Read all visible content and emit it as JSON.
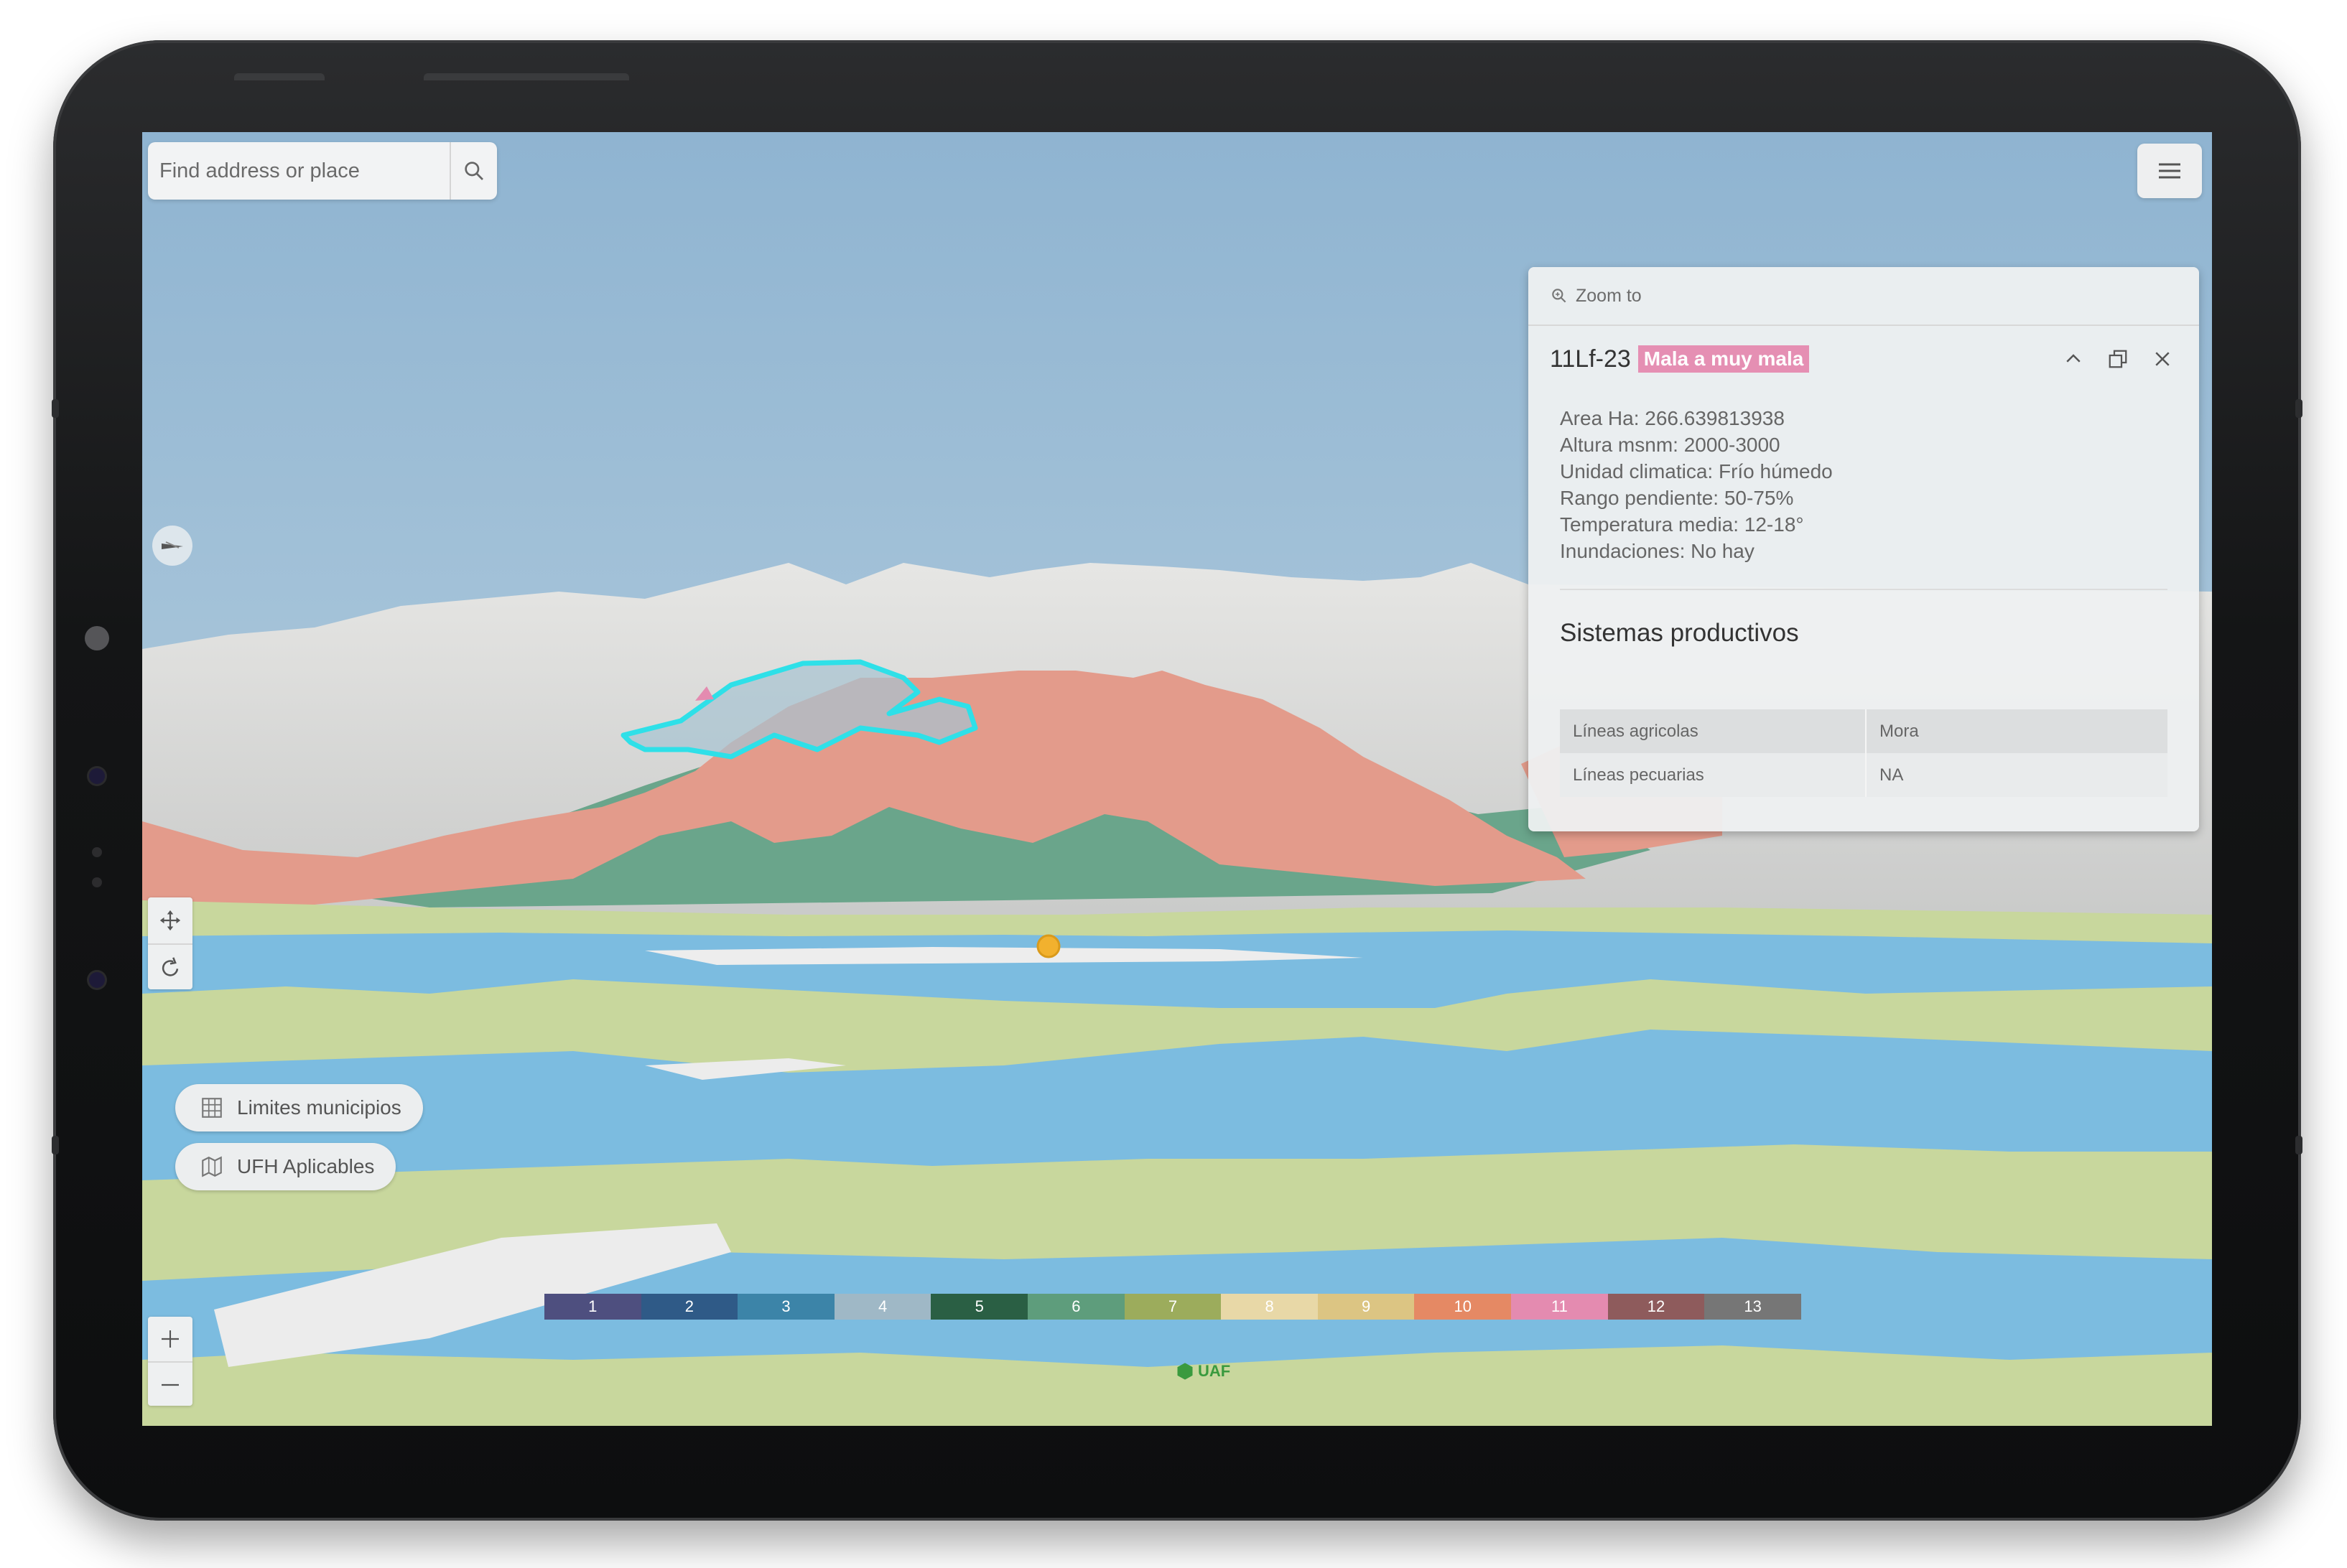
{
  "search": {
    "placeholder": "Find address or place",
    "icon": "search-icon"
  },
  "toolbar": {
    "menu_icon": "hamburger-menu-icon"
  },
  "popup": {
    "zoom_to_label": "Zoom to",
    "title": "11Lf-23",
    "badge": "Mala a muy mala",
    "badge_color": "#e58fb3",
    "attributes": [
      "Area Ha: 266.639813938",
      "Altura msnm: 2000-3000",
      "Unidad climatica: Frío húmedo",
      "Rango pendiente: 50-75%",
      "Temperatura media: 12-18°",
      "Inundaciones: No hay"
    ],
    "section_title": "Sistemas productivos",
    "table": [
      {
        "key": "Líneas agricolas",
        "value": "Mora"
      },
      {
        "key": "Líneas pecuarias",
        "value": "NA"
      }
    ]
  },
  "layers": [
    {
      "label": "Limites municipios",
      "icon": "grid-icon"
    },
    {
      "label": "UFH Aplicables",
      "icon": "map-layers-icon"
    }
  ],
  "legend": [
    {
      "label": "1",
      "color": "#4e4f7f"
    },
    {
      "label": "2",
      "color": "#2f5a87"
    },
    {
      "label": "3",
      "color": "#3c84a8"
    },
    {
      "label": "4",
      "color": "#9fb8c6"
    },
    {
      "label": "5",
      "color": "#2a5f44"
    },
    {
      "label": "6",
      "color": "#5e9d7c"
    },
    {
      "label": "7",
      "color": "#9cac5c"
    },
    {
      "label": "8",
      "color": "#e8d8a7"
    },
    {
      "label": "9",
      "color": "#dcc583"
    },
    {
      "label": "10",
      "color": "#e58964"
    },
    {
      "label": "11",
      "color": "#e48bb0"
    },
    {
      "label": "12",
      "color": "#8e5b5c"
    },
    {
      "label": "13",
      "color": "#767676"
    }
  ],
  "logo": {
    "text": "UAF",
    "color": "#3a9a3e"
  },
  "map_colors": {
    "sky_top": "#8fb4d1",
    "sky_bottom": "#c5d9e4",
    "snow_mountains": "#d9d9d8",
    "red_hills": "#e39b8b",
    "green_plain": "#c8d79d",
    "water": "#7cbce0",
    "selection_outline": "#2ee0e8"
  }
}
